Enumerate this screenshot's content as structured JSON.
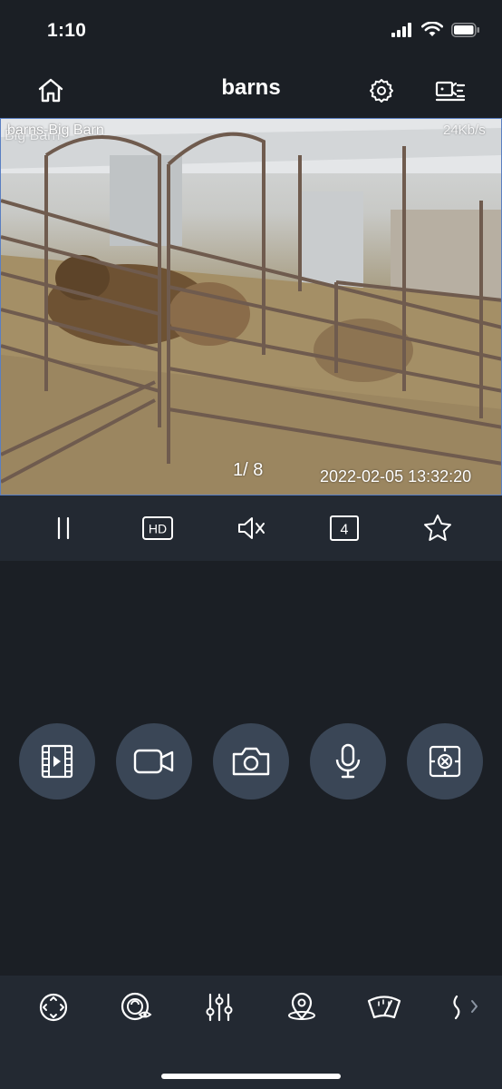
{
  "status_bar": {
    "time": "1:10"
  },
  "nav": {
    "title": "barns"
  },
  "video": {
    "camera_label": "barns-Big Barn",
    "camera_label_ghost": "Big Barn",
    "bitrate": "24Kb/s",
    "page_indicator": "1/ 8",
    "timestamp": "2022-02-05  13:32:20"
  },
  "controls": {
    "hd_label": "HD",
    "split_count": "4"
  },
  "actions": [
    {
      "name": "playback-icon"
    },
    {
      "name": "record-icon"
    },
    {
      "name": "snapshot-icon"
    },
    {
      "name": "microphone-icon"
    },
    {
      "name": "ptz-reset-icon"
    }
  ],
  "toolbar": [
    {
      "name": "ptz-direction-icon"
    },
    {
      "name": "focus-view-icon"
    },
    {
      "name": "image-settings-icon"
    },
    {
      "name": "preset-location-icon"
    },
    {
      "name": "wiper-icon"
    },
    {
      "name": "more-icon"
    }
  ]
}
